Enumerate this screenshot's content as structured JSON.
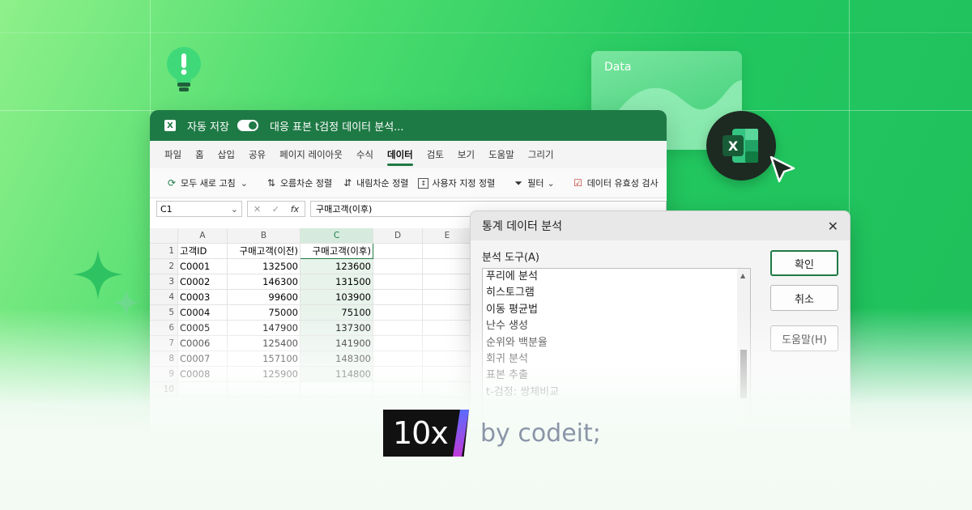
{
  "colors": {
    "excel_green": "#1e7a45",
    "bg_green": "#22c760",
    "brand_gradient_start": "#5b6bff",
    "brand_gradient_end": "#c13ad8"
  },
  "decor": {
    "bulb": "lightbulb-exclamation-icon",
    "sparkle": "sparkle-icon",
    "cursor": "arrow-cursor-icon",
    "excel_logo": "excel-logo-icon"
  },
  "data_card": {
    "label": "Data"
  },
  "excel": {
    "autosave_label": "자동 저장",
    "document_title": "대응 표본 t검정 데이터 분석...",
    "tabs": [
      "파일",
      "홈",
      "삽입",
      "공유",
      "페이지 레이아웃",
      "수식",
      "데이터",
      "검토",
      "보기",
      "도움말",
      "그리기"
    ],
    "active_tab": "데이터",
    "ribbon": {
      "refresh_all": "모두 새로 고침",
      "sort_asc": "오름차순 정렬",
      "sort_desc": "내림차순 정렬",
      "custom_sort": "사용자 지정 정렬",
      "filter": "필터",
      "data_validation": "데이터 유효성 검사"
    },
    "name_box": "C1",
    "formula": "구매고객(이후)",
    "columns": [
      "A",
      "B",
      "C",
      "D",
      "E"
    ],
    "rows": [
      {
        "n": "1",
        "a": "고객ID",
        "b": "구매고객(이전)",
        "c": "구매고객(이후)"
      },
      {
        "n": "2",
        "a": "C0001",
        "b": "132500",
        "c": "123600"
      },
      {
        "n": "3",
        "a": "C0002",
        "b": "146300",
        "c": "131500"
      },
      {
        "n": "4",
        "a": "C0003",
        "b": "99600",
        "c": "103900"
      },
      {
        "n": "5",
        "a": "C0004",
        "b": "75000",
        "c": "75100"
      },
      {
        "n": "6",
        "a": "C0005",
        "b": "147900",
        "c": "137300"
      },
      {
        "n": "7",
        "a": "C0006",
        "b": "125400",
        "c": "141900"
      },
      {
        "n": "8",
        "a": "C0007",
        "b": "157100",
        "c": "148300"
      },
      {
        "n": "9",
        "a": "C0008",
        "b": "125900",
        "c": "114800"
      },
      {
        "n": "10",
        "a": "",
        "b": "",
        "c": ""
      }
    ]
  },
  "dialog": {
    "title": "통계 데이터 분석",
    "tools_label": "분석 도구(A)",
    "tools": [
      "푸리에 분석",
      "히스토그램",
      "이동 평균법",
      "난수 생성",
      "순위와 백분율",
      "회귀 분석",
      "표본 추출",
      "t-검정: 쌍체비교"
    ],
    "ok": "확인",
    "cancel": "취소",
    "help": "도움말(H)"
  },
  "brand": {
    "logo_text": "10x",
    "byline": "by codeit;"
  }
}
